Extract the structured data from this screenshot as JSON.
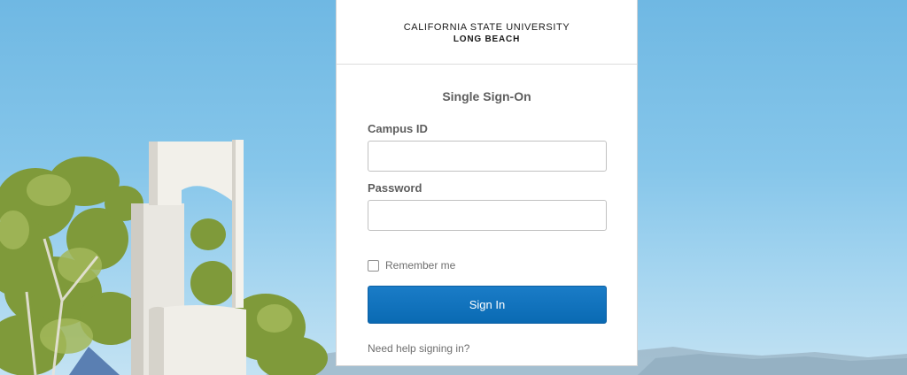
{
  "brand": {
    "university_line1": "CALIFORNIA STATE UNIVERSITY",
    "university_line2": "LONG BEACH"
  },
  "form": {
    "title": "Single Sign-On",
    "campus_id_label": "Campus ID",
    "campus_id_value": "",
    "password_label": "Password",
    "password_value": "",
    "remember_label": "Remember me",
    "remember_checked": false,
    "signin_label": "Sign In",
    "help_link": "Need help signing in?"
  },
  "colors": {
    "primary_button": "#0a6ab3",
    "sky": "#86c6ea",
    "label_text": "#5e5e5e"
  },
  "icons": {
    "checkbox": "checkbox-unchecked-icon"
  }
}
